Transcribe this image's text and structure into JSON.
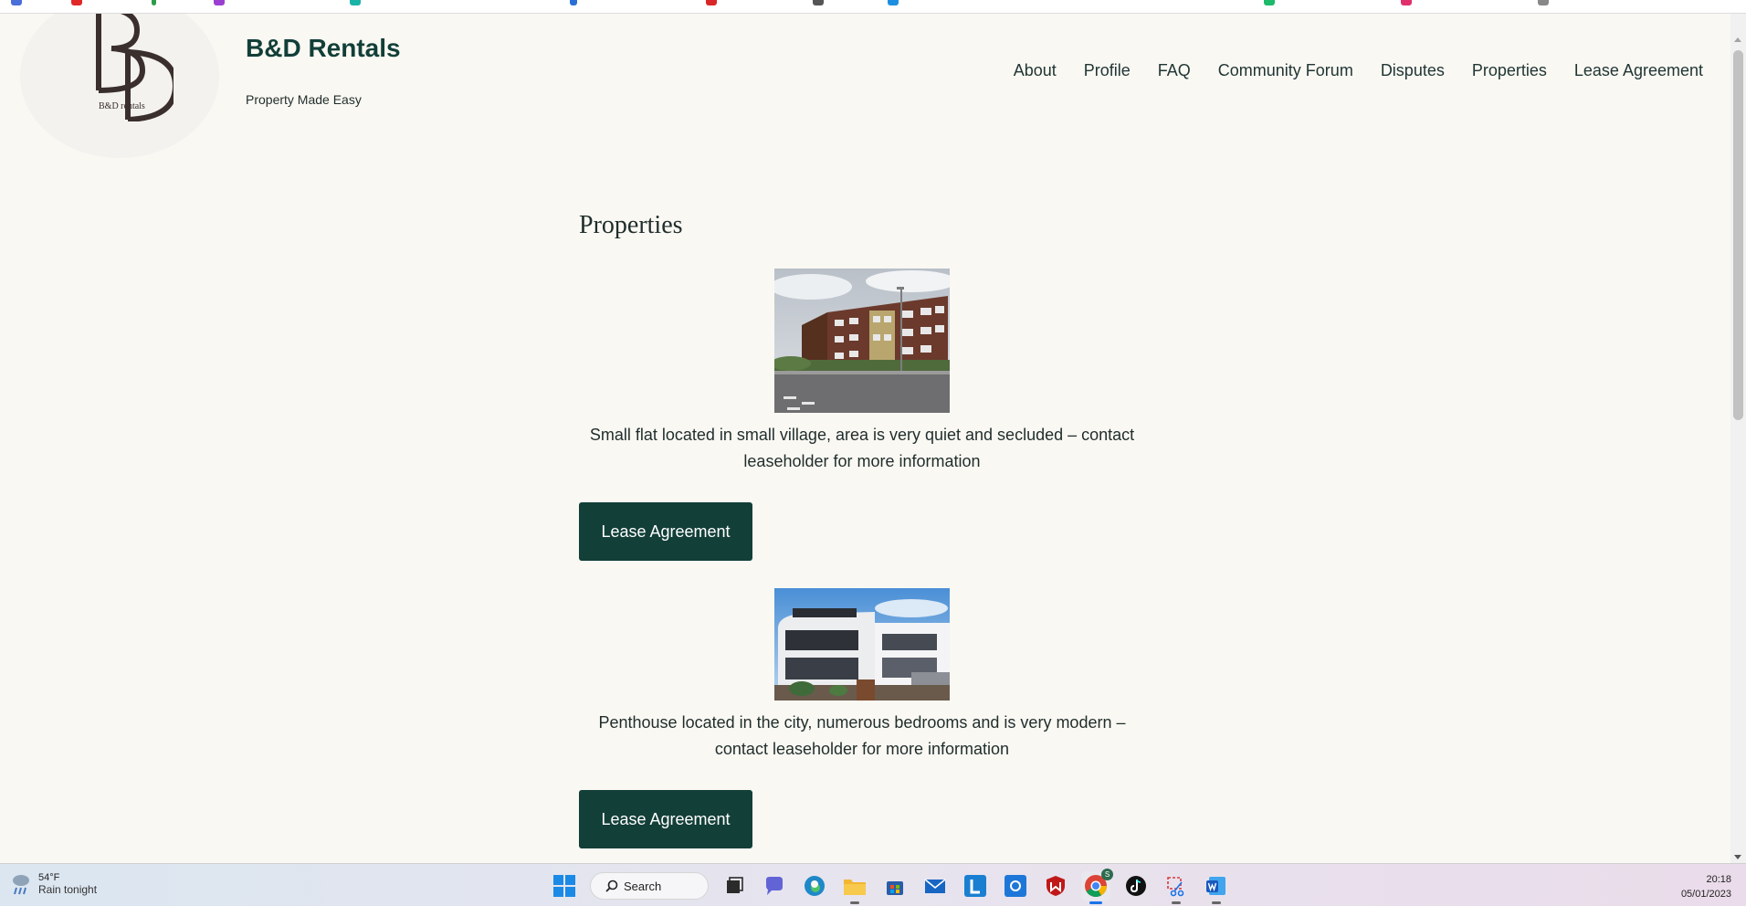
{
  "site": {
    "title": "B&D Rentals",
    "tagline": "Property Made Easy",
    "logo_text": "B&D rentals",
    "logo_letters": "BD"
  },
  "nav": [
    {
      "label": "About"
    },
    {
      "label": "Profile"
    },
    {
      "label": "FAQ"
    },
    {
      "label": "Community Forum"
    },
    {
      "label": "Disputes"
    },
    {
      "label": "Properties"
    },
    {
      "label": "Lease Agreement"
    }
  ],
  "page": {
    "heading": "Properties"
  },
  "properties": [
    {
      "image_icon": "brick-apartment-block-photo",
      "description": "Small flat located in small village, area is very quiet and secluded – contact leaseholder for more information",
      "button_label": "Lease Agreement"
    },
    {
      "image_icon": "modern-penthouse-photo",
      "description": "Penthouse located in the city, numerous bedrooms and is very modern – contact leaseholder for more information",
      "button_label": "Lease Agreement"
    }
  ],
  "taskbar": {
    "weather_temp": "54°F",
    "weather_condition": "Rain tonight",
    "search_label": "Search",
    "time": "20:18",
    "date": "05/01/2023",
    "chrome_badge": "S"
  },
  "colors": {
    "brand": "#123f38",
    "background": "#faf8f3"
  }
}
